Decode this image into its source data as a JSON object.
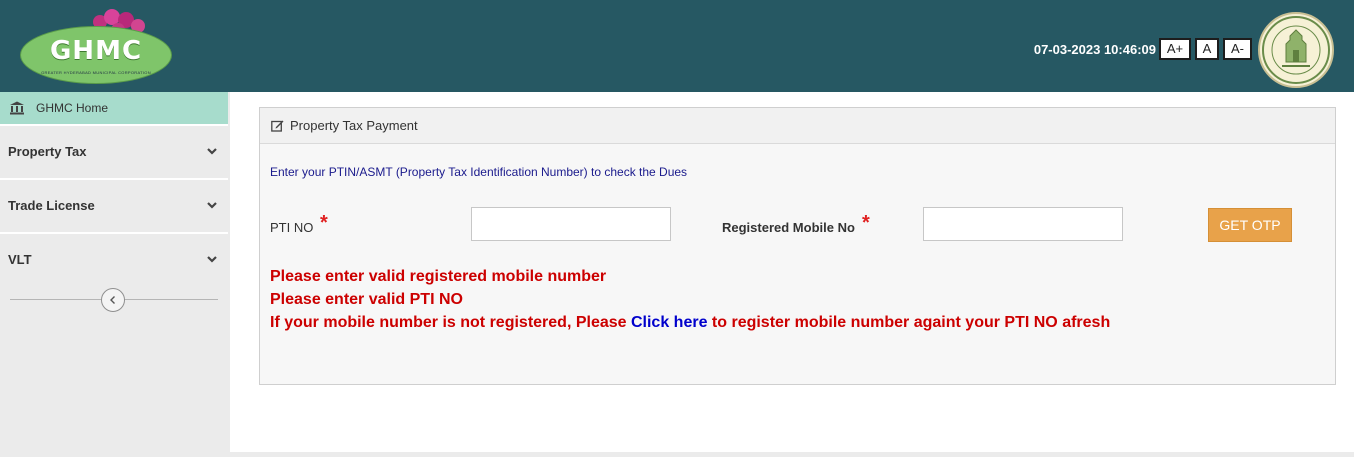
{
  "header": {
    "logo_text": "GHMC",
    "logo_subtext": "GREATER HYDERABAD MUNICIPAL CORPORATION",
    "datetime": "07-03-2023 10:46:09",
    "font_controls": [
      "A+",
      "A",
      "A-"
    ],
    "emblem_text": "GOVERNMENT OF TELANGANA"
  },
  "sidebar": {
    "home_label": "GHMC Home",
    "items": [
      {
        "label": "Property Tax"
      },
      {
        "label": "Trade License"
      },
      {
        "label": "VLT"
      }
    ]
  },
  "panel": {
    "title": "Property Tax Payment",
    "info": "Enter your PTIN/ASMT (Property Tax Identification Number) to check the Dues",
    "pti_label": "PTI NO",
    "mobile_label": "Registered Mobile No",
    "required_mark": "*",
    "pti_value": "",
    "mobile_value": "",
    "otp_button": "GET OTP",
    "errors": {
      "mobile": "Please enter valid registered mobile number",
      "pti": "Please enter valid PTI NO",
      "register_prefix": "If your mobile number is not registered, Please ",
      "register_link": "Click here",
      "register_suffix": " to register mobile number againt your PTI NO afresh"
    }
  },
  "colors": {
    "header_bg": "#265863",
    "home_item_bg": "#a7dccc",
    "button_orange": "#e8a24a",
    "error_red": "#cc0000",
    "link_blue": "#0000cc"
  }
}
